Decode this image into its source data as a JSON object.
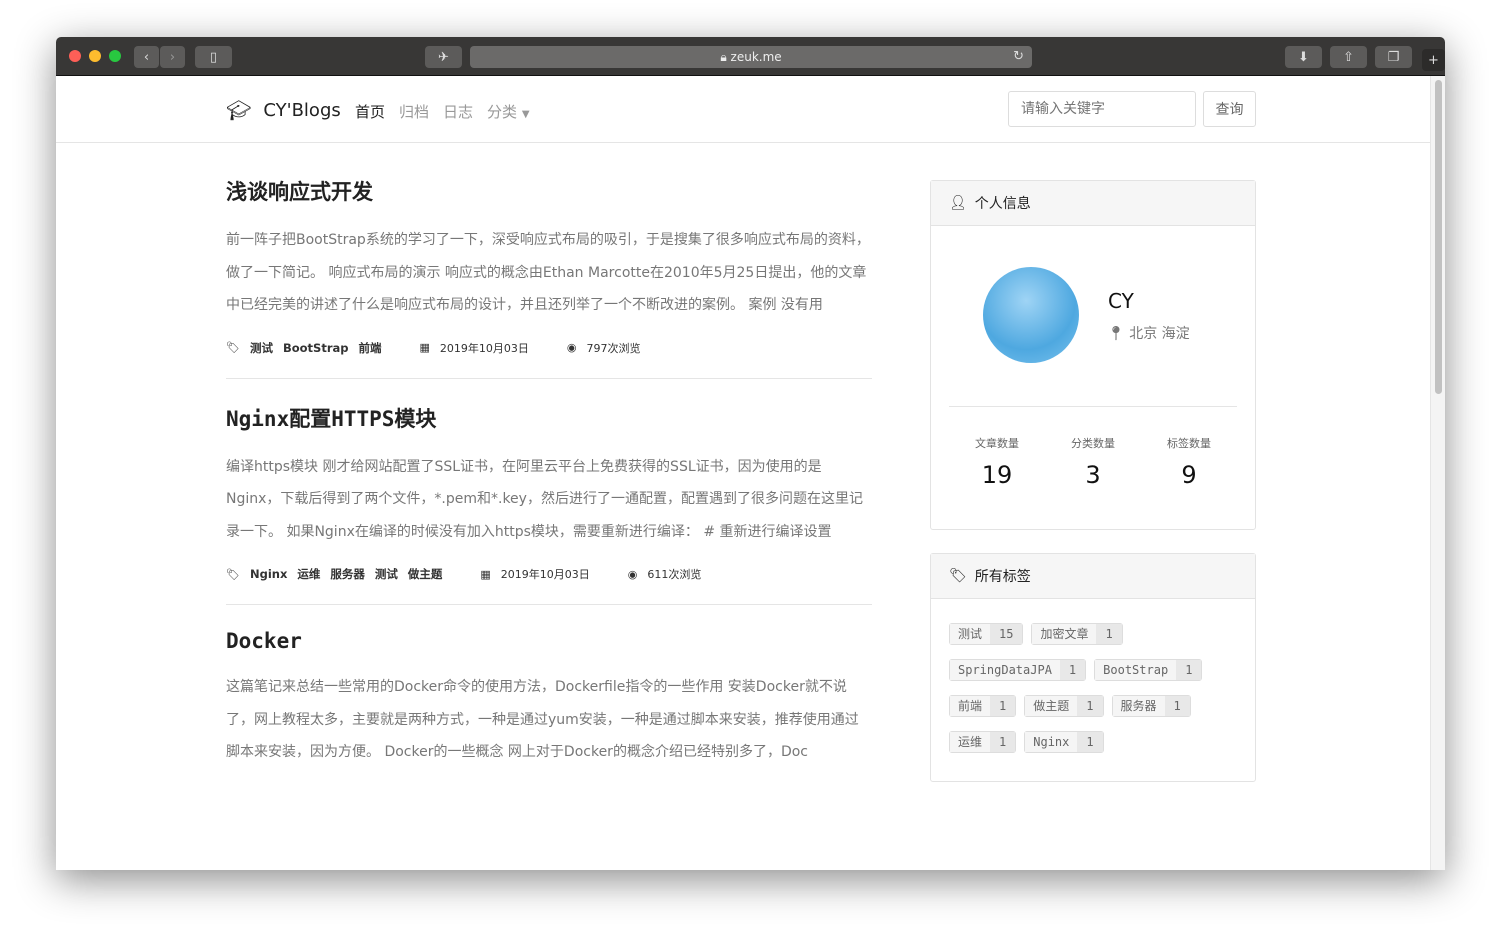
{
  "browser": {
    "url": "zeuk.me",
    "colors": {
      "close": "#fe5f57",
      "minimize": "#febc2e",
      "maximize": "#28c840"
    }
  },
  "nav": {
    "brand": "CY'Blogs",
    "links": [
      "首页",
      "归档",
      "日志",
      "分类"
    ],
    "search_placeholder": "请输入关键字",
    "search_button": "查询"
  },
  "posts": [
    {
      "title": "浅谈响应式开发",
      "excerpt": "前一阵子把BootStrap系统的学习了一下，深受响应式布局的吸引，于是搜集了很多响应式布局的资料，做了一下简记。 响应式布局的演示 响应式的概念由Ethan Marcotte在2010年5月25日提出，他的文章中已经完美的讲述了什么是响应式布局的设计，并且还列举了一个不断改进的案例。 案例 没有用",
      "tags": [
        "测试",
        "BootStrap",
        "前端"
      ],
      "date": "2019年10月03日",
      "views": "797次浏览"
    },
    {
      "title": "Nginx配置HTTPS模块",
      "excerpt": "编译https模块 刚才给网站配置了SSL证书，在阿里云平台上免费获得的SSL证书，因为使用的是Nginx，下载后得到了两个文件，*.pem和*.key，然后进行了一通配置，配置遇到了很多问题在这里记录一下。 如果Nginx在编译的时候没有加入https模块，需要重新进行编译： # 重新进行编译设置",
      "tags": [
        "Nginx",
        "运维",
        "服务器",
        "测试",
        "做主题"
      ],
      "date": "2019年10月03日",
      "views": "611次浏览"
    },
    {
      "title": "Docker",
      "excerpt": "这篇笔记来总结一些常用的Docker命令的使用方法，Dockerfile指令的一些作用 安装Docker就不说了，网上教程太多，主要就是两种方式，一种是通过yum安装，一种是通过脚本来安装，推荐使用通过脚本来安装，因为方便。 Docker的一些概念 网上对于Docker的概念介绍已经特别多了，Doc",
      "tags": [],
      "date": "",
      "views": ""
    }
  ],
  "profile": {
    "header": "个人信息",
    "name": "CY",
    "location": "北京 海淀",
    "stats": [
      {
        "label": "文章数量",
        "value": "19"
      },
      {
        "label": "分类数量",
        "value": "3"
      },
      {
        "label": "标签数量",
        "value": "9"
      }
    ]
  },
  "tags_panel": {
    "header": "所有标签",
    "tags": [
      {
        "name": "测试",
        "count": "15"
      },
      {
        "name": "加密文章",
        "count": "1"
      },
      {
        "name": "SpringDataJPA",
        "count": "1"
      },
      {
        "name": "BootStrap",
        "count": "1"
      },
      {
        "name": "前端",
        "count": "1"
      },
      {
        "name": "做主题",
        "count": "1"
      },
      {
        "name": "服务器",
        "count": "1"
      },
      {
        "name": "运维",
        "count": "1"
      },
      {
        "name": "Nginx",
        "count": "1"
      }
    ]
  }
}
